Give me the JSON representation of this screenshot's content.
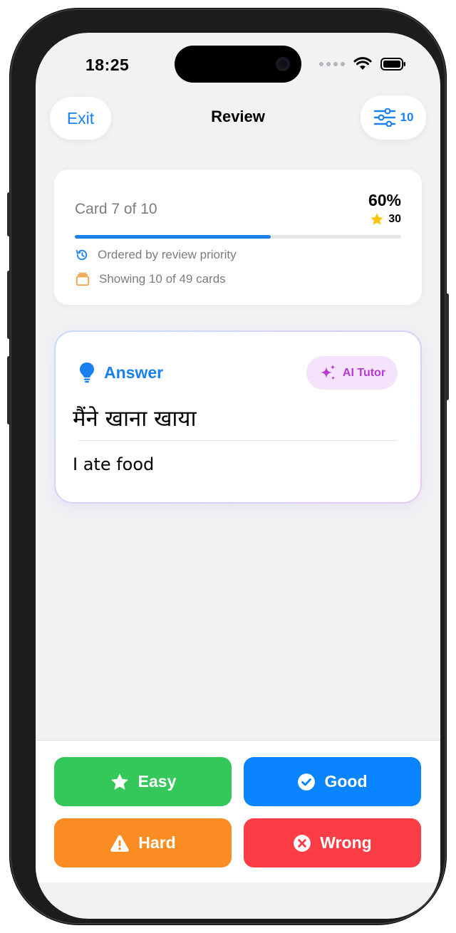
{
  "status_bar": {
    "time": "18:25"
  },
  "nav": {
    "exit_label": "Exit",
    "title": "Review",
    "filter_count": "10"
  },
  "progress": {
    "card_label": "Card 7 of 10",
    "percent_label": "60%",
    "stars_count": "30",
    "fraction": 0.6,
    "ordering_text": "Ordered by review priority",
    "showing_text": "Showing 10 of 49 cards"
  },
  "answer_card": {
    "heading": "Answer",
    "ai_tutor_label": "AI Tutor",
    "source_text": "मैंने खाना खाया",
    "translation": "I ate food"
  },
  "actions": {
    "easy_label": "Easy",
    "good_label": "Good",
    "hard_label": "Hard",
    "wrong_label": "Wrong"
  },
  "colors": {
    "accent": "#1a80f0",
    "ai_purple": "#b53bd0",
    "easy": "#34c759",
    "good": "#0a84ff",
    "hard": "#fb8c23",
    "wrong": "#fa3c44",
    "star": "#ffc30b",
    "stack_orange": "#f59e3b"
  },
  "icons": [
    "history-icon",
    "card-stack-icon",
    "lightbulb-icon",
    "sparkles-icon",
    "star-icon",
    "check-circle-icon",
    "warning-icon",
    "x-circle-icon",
    "sliders-icon",
    "wifi-icon",
    "battery-icon"
  ]
}
